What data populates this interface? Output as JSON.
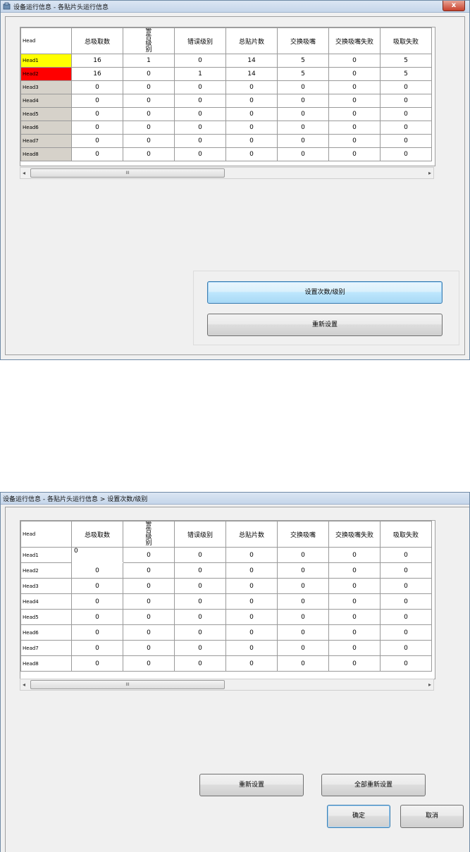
{
  "window1": {
    "title": "设备运行信息 - 各贴片头运行信息",
    "close_label": "x",
    "columns": [
      "Head",
      "总吸取数",
      "警告级别",
      "错误级别",
      "总贴片数",
      "交换吸嘴",
      "交换吸嘴失败",
      "吸取失败"
    ],
    "rows": [
      {
        "head": "Head1",
        "values": [
          "16",
          "1",
          "0",
          "14",
          "5",
          "0",
          "5"
        ]
      },
      {
        "head": "Head2",
        "values": [
          "16",
          "0",
          "1",
          "14",
          "5",
          "0",
          "5"
        ]
      },
      {
        "head": "Head3",
        "values": [
          "0",
          "0",
          "0",
          "0",
          "0",
          "0",
          "0"
        ]
      },
      {
        "head": "Head4",
        "values": [
          "0",
          "0",
          "0",
          "0",
          "0",
          "0",
          "0"
        ]
      },
      {
        "head": "Head5",
        "values": [
          "0",
          "0",
          "0",
          "0",
          "0",
          "0",
          "0"
        ]
      },
      {
        "head": "Head6",
        "values": [
          "0",
          "0",
          "0",
          "0",
          "0",
          "0",
          "0"
        ]
      },
      {
        "head": "Head7",
        "values": [
          "0",
          "0",
          "0",
          "0",
          "0",
          "0",
          "0"
        ]
      },
      {
        "head": "Head8",
        "values": [
          "0",
          "0",
          "0",
          "0",
          "0",
          "0",
          "0"
        ]
      }
    ],
    "scroll_thumb_label": "III",
    "set_button": "设置次数/级别",
    "reset_button": "重新设置"
  },
  "window2": {
    "title": "设备运行信息 - 各贴片头运行信息 > 设置次数/级别",
    "columns": [
      "Head",
      "总吸取数",
      "警告级别",
      "错误级别",
      "总贴片数",
      "交换吸嘴",
      "交换吸嘴失败",
      "吸取失败"
    ],
    "rows": [
      {
        "head": "Head1",
        "values": [
          "0",
          "0",
          "0",
          "0",
          "0",
          "0",
          "0"
        ]
      },
      {
        "head": "Head2",
        "values": [
          "0",
          "0",
          "0",
          "0",
          "0",
          "0",
          "0"
        ]
      },
      {
        "head": "Head3",
        "values": [
          "0",
          "0",
          "0",
          "0",
          "0",
          "0",
          "0"
        ]
      },
      {
        "head": "Head4",
        "values": [
          "0",
          "0",
          "0",
          "0",
          "0",
          "0",
          "0"
        ]
      },
      {
        "head": "Head5",
        "values": [
          "0",
          "0",
          "0",
          "0",
          "0",
          "0",
          "0"
        ]
      },
      {
        "head": "Head6",
        "values": [
          "0",
          "0",
          "0",
          "0",
          "0",
          "0",
          "0"
        ]
      },
      {
        "head": "Head7",
        "values": [
          "0",
          "0",
          "0",
          "0",
          "0",
          "0",
          "0"
        ]
      },
      {
        "head": "Head8",
        "values": [
          "0",
          "0",
          "0",
          "0",
          "0",
          "0",
          "0"
        ]
      }
    ],
    "scroll_thumb_label": "III",
    "reset_button": "重新设置",
    "reset_all_button": "全部重新设置",
    "ok_button": "确定",
    "cancel_button": "取消"
  },
  "colors": {
    "head1_status": "#ffff00",
    "head2_status": "#ff0000",
    "row_header": "#d6d2ca"
  }
}
